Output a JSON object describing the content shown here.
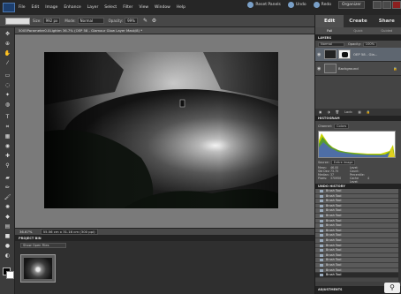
{
  "menubar": {
    "items": [
      "File",
      "Edit",
      "Image",
      "Enhance",
      "Layer",
      "Select",
      "Filter",
      "View",
      "Window",
      "Help"
    ],
    "reset_panels": "Reset Panels",
    "undo": "Undo",
    "redo": "Redo",
    "organizer": "Organizer"
  },
  "options": {
    "size_label": "Size:",
    "size_value": "992 px",
    "mode_label": "Mode:",
    "mode_value": "Normal",
    "opacity_label": "Opacity:",
    "opacity_value": "99%"
  },
  "document": {
    "tab_title": "5005Parameter0.0Lightm 36.7% (OEP 58 - Glamour Glow Layer Mask/8) *",
    "zoom_status": "36.67%",
    "size_status": "55.56 cm x 31.16 cm (300 ppi)"
  },
  "project_bin": {
    "title": "PROJECT BIN",
    "selector": "Show Open Files"
  },
  "panel": {
    "modes": [
      "Edit",
      "Create",
      "Share"
    ],
    "submodes": [
      "Full",
      "Quick",
      "Guided"
    ],
    "layers_title": "LAYERS",
    "blend_mode": "Normal",
    "opacity_label": "Opacity:",
    "opacity_value": "100%",
    "lock_label": "Lock:",
    "layers": [
      {
        "name": "OEP 58 - Gla..."
      },
      {
        "name": "Background"
      }
    ],
    "histogram_title": "HISTOGRAM",
    "channel_label": "Channel:",
    "channel_value": "Colors",
    "source_label": "Source:",
    "source_value": "Entire Image",
    "stats": [
      [
        "Mean:",
        "46.00",
        "Level:",
        ""
      ],
      [
        "Std Dev:",
        "73.75",
        "Count:",
        ""
      ],
      [
        "Median:",
        "37",
        "Percentile:",
        ""
      ],
      [
        "Pixels:",
        "370950",
        "Cache Level:",
        "4"
      ]
    ],
    "undo_title": "UNDO HISTORY",
    "undo_items": [
      "Brush Tool",
      "Brush Tool",
      "Brush Tool",
      "Brush Tool",
      "Brush Tool",
      "Brush Tool",
      "Brush Tool",
      "Brush Tool",
      "Brush Tool",
      "Brush Tool",
      "Brush Tool",
      "Brush Tool",
      "Brush Tool",
      "Brush Tool",
      "Brush Tool",
      "Brush Tool",
      "Brush Tool",
      "Brush Tool"
    ],
    "adjustments_title": "ADJUSTMENTS"
  }
}
